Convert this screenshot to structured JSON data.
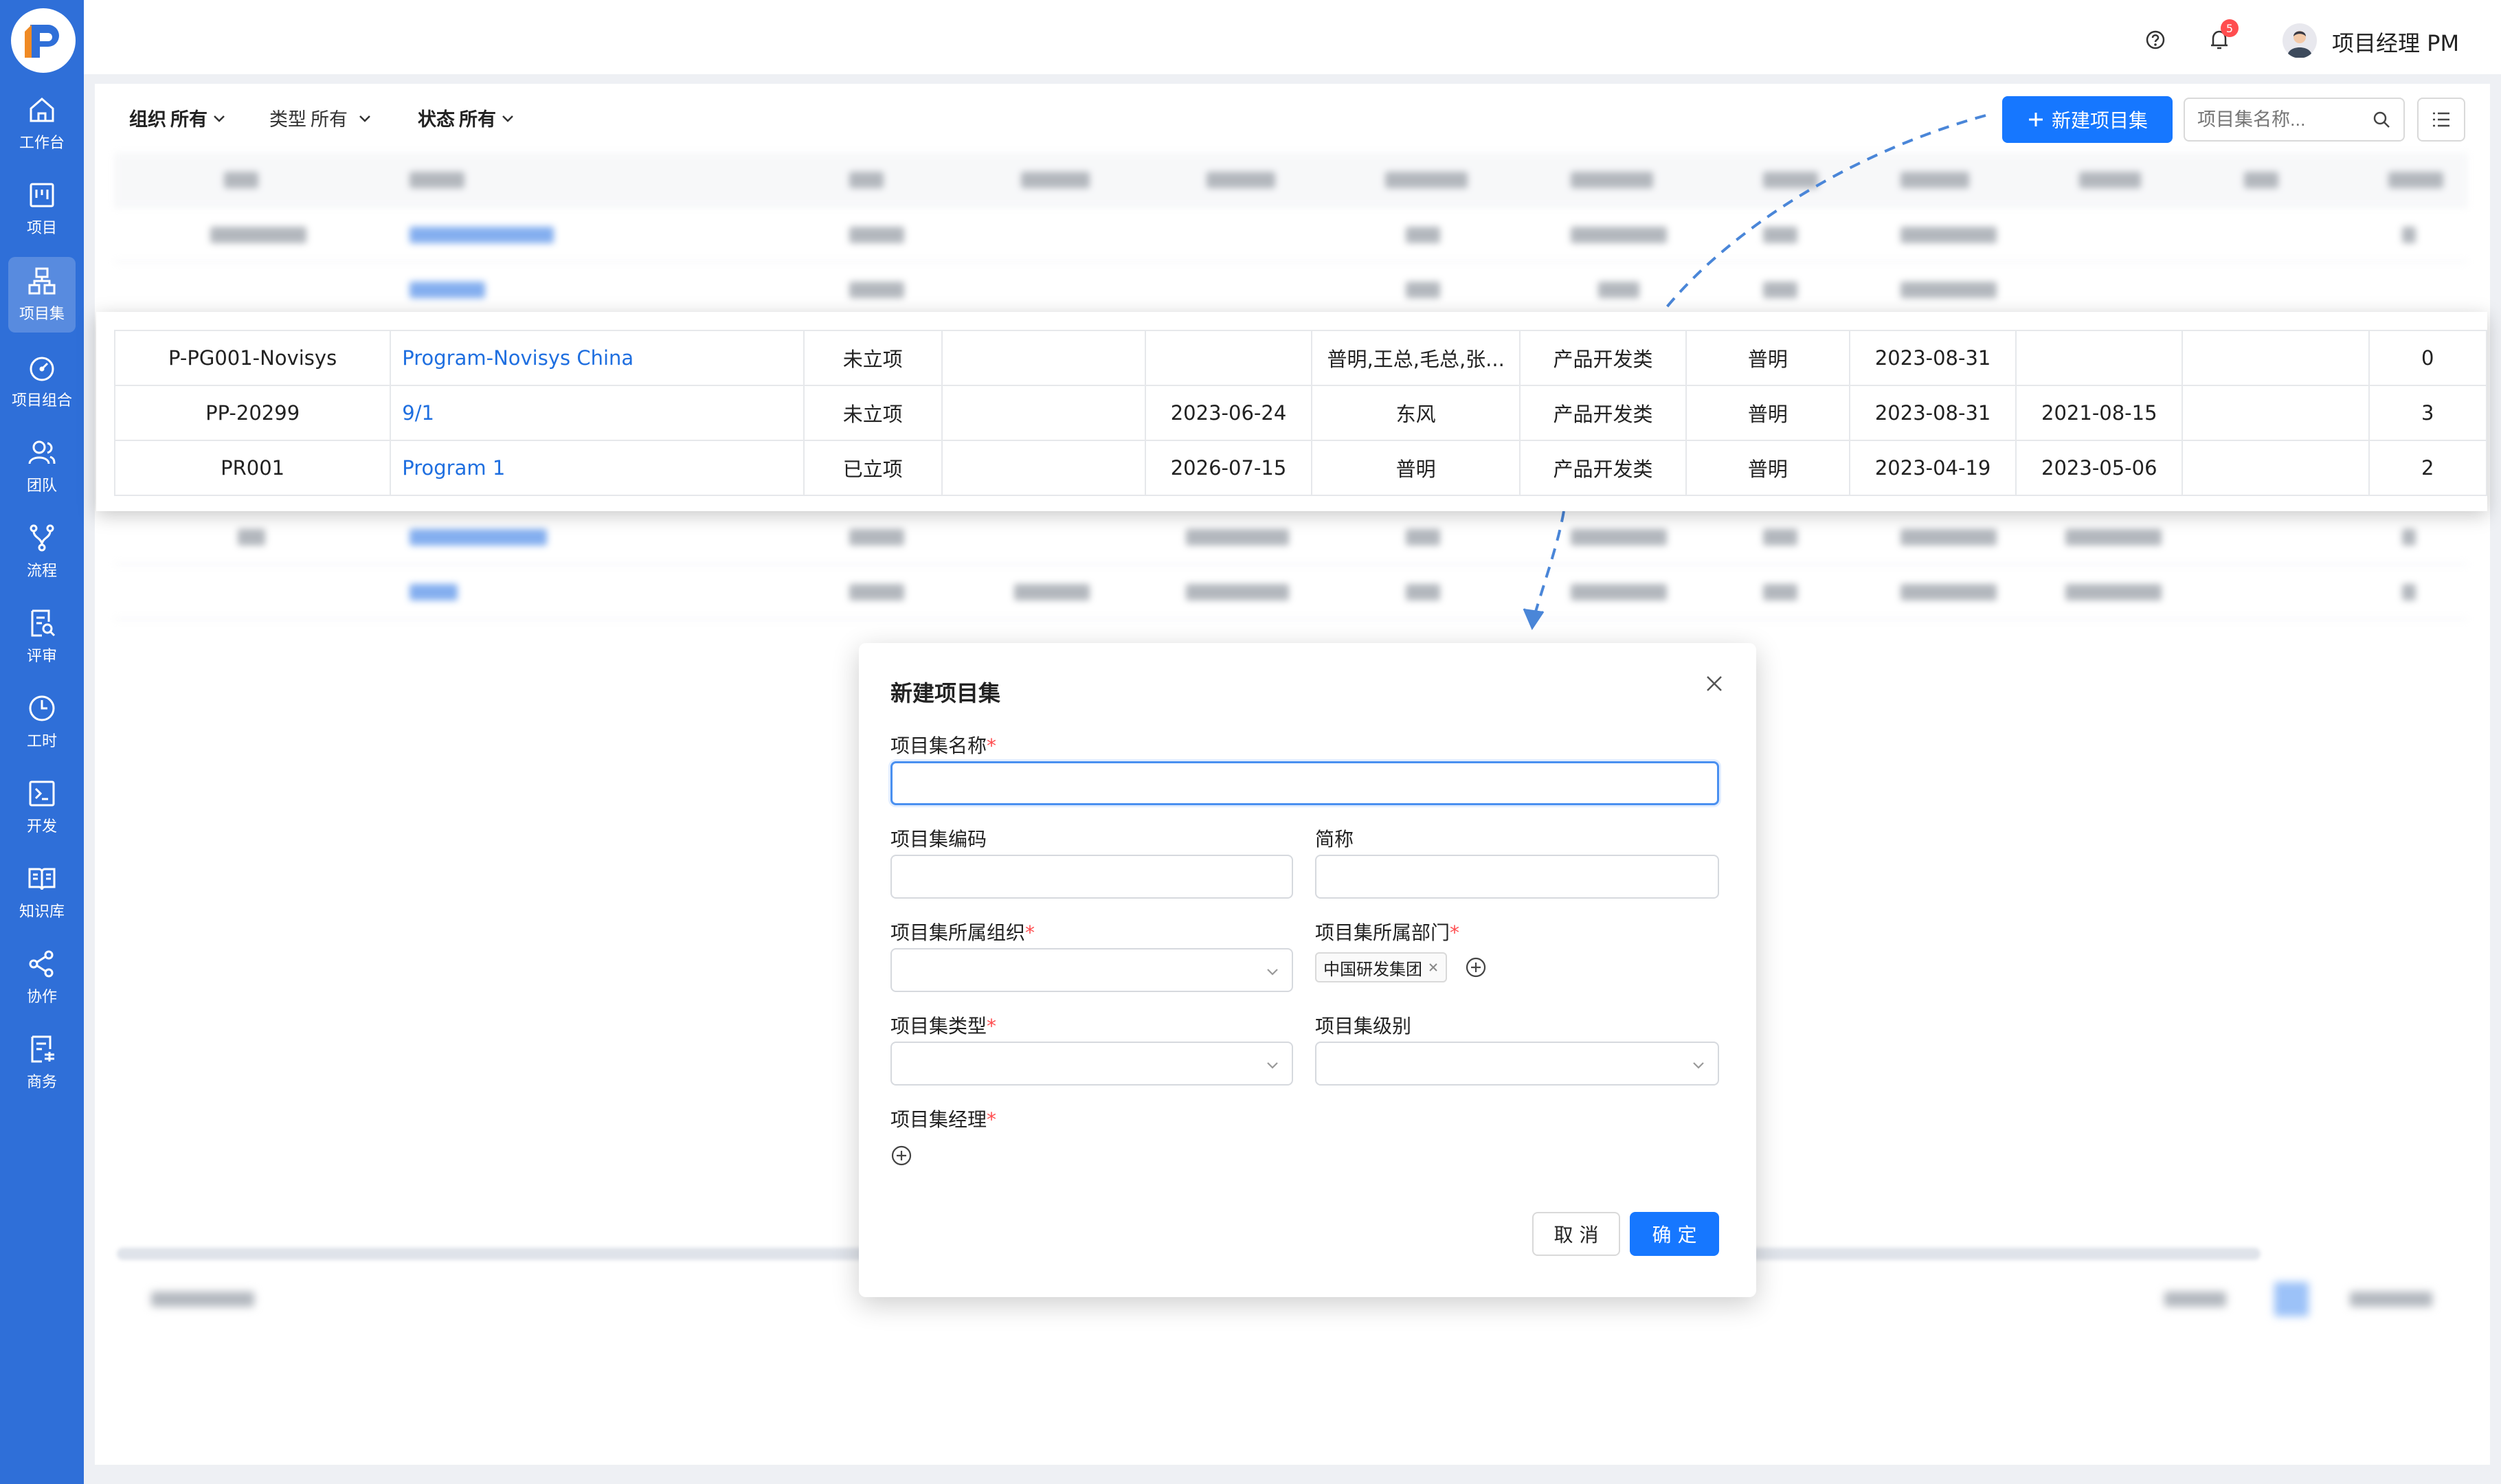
{
  "sidebar": {
    "items": [
      {
        "label": "工作台",
        "icon": "home-icon"
      },
      {
        "label": "项目",
        "icon": "project-icon"
      },
      {
        "label": "项目集",
        "icon": "program-icon",
        "active": true
      },
      {
        "label": "项目组合",
        "icon": "dashboard-icon"
      },
      {
        "label": "团队",
        "icon": "team-icon"
      },
      {
        "label": "流程",
        "icon": "workflow-icon"
      },
      {
        "label": "评审",
        "icon": "review-icon"
      },
      {
        "label": "工时",
        "icon": "clock-icon"
      },
      {
        "label": "开发",
        "icon": "terminal-icon"
      },
      {
        "label": "知识库",
        "icon": "book-icon"
      },
      {
        "label": "协作",
        "icon": "share-icon"
      },
      {
        "label": "商务",
        "icon": "business-icon"
      }
    ]
  },
  "header": {
    "user_name": "项目经理 PM",
    "notification_count": "5"
  },
  "filters": [
    {
      "key": "组织",
      "value": "所有"
    },
    {
      "key": "类型",
      "value": "所有"
    },
    {
      "key": "状态",
      "value": "所有"
    }
  ],
  "toolbar": {
    "new_button_label": "新建项目集",
    "search_placeholder": "项目集名称..."
  },
  "table": {
    "rows": [
      [
        "P-PG001-Novisys",
        "Program-Novisys China",
        "未立项",
        "",
        "",
        "普明,王总,毛总,张...",
        "产品开发类",
        "普明",
        "2023-08-31",
        "",
        "",
        "0"
      ],
      [
        "PP-20299",
        "9/1",
        "未立项",
        "",
        "2023-06-24",
        "东风",
        "产品开发类",
        "普明",
        "2023-08-31",
        "2021-08-15",
        "",
        "3"
      ],
      [
        "PR001",
        "Program 1",
        "已立项",
        "",
        "2026-07-15",
        "普明",
        "产品开发类",
        "普明",
        "2023-04-19",
        "2023-05-06",
        "",
        "2"
      ]
    ]
  },
  "modal": {
    "title": "新建项目集",
    "name_label": "项目集名称",
    "code_label": "项目集编码",
    "short_label": "简称",
    "org_label": "项目集所属组织",
    "dept_label": "项目集所属部门",
    "dept_tag": "中国研发集团",
    "type_label": "项目集类型",
    "level_label": "项目集级别",
    "manager_label": "项目集经理",
    "cancel_label": "取 消",
    "ok_label": "确 定"
  },
  "colors": {
    "sidebar": "#2f6fd8",
    "primary": "#1677ff",
    "required": "#ff4d4f",
    "link": "#1f6fe0"
  }
}
